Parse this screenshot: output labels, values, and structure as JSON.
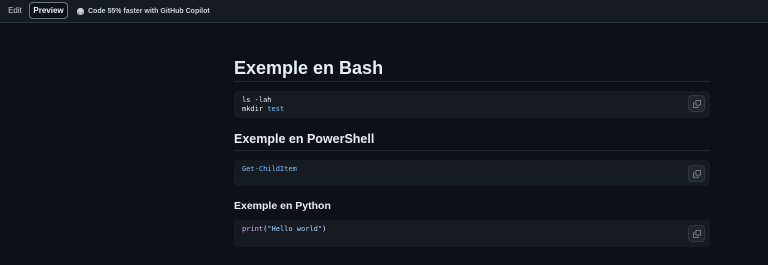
{
  "toolbar": {
    "edit_label": "Edit",
    "preview_label": "Preview",
    "copilot_text": "Code 55% faster with GitHub Copilot"
  },
  "sections": [
    {
      "heading": "Exemple en Bash",
      "code": [
        [
          {
            "text": "ls -lah",
            "style": "plain"
          }
        ],
        [
          {
            "text": "mkdir ",
            "style": "plain"
          },
          {
            "text": "test",
            "style": "kw"
          }
        ]
      ]
    },
    {
      "heading": "Exemple en PowerShell",
      "code": [
        [
          {
            "text": "Get-ChildItem",
            "style": "kw"
          }
        ]
      ]
    },
    {
      "heading": "Exemple en Python",
      "code": [
        [
          {
            "text": "print",
            "style": "fn"
          },
          {
            "text": "(",
            "style": "plain"
          },
          {
            "text": "\"Hello world\"",
            "style": "str"
          },
          {
            "text": ")",
            "style": "plain"
          }
        ]
      ]
    }
  ],
  "icons": {
    "copilot": "copilot-icon",
    "copy": "copy-icon"
  },
  "colors": {
    "background": "#0d1117",
    "code_background": "#161b22",
    "keyword": "#79c0ff",
    "function": "#d2a8ff",
    "string": "#a5d6ff"
  }
}
